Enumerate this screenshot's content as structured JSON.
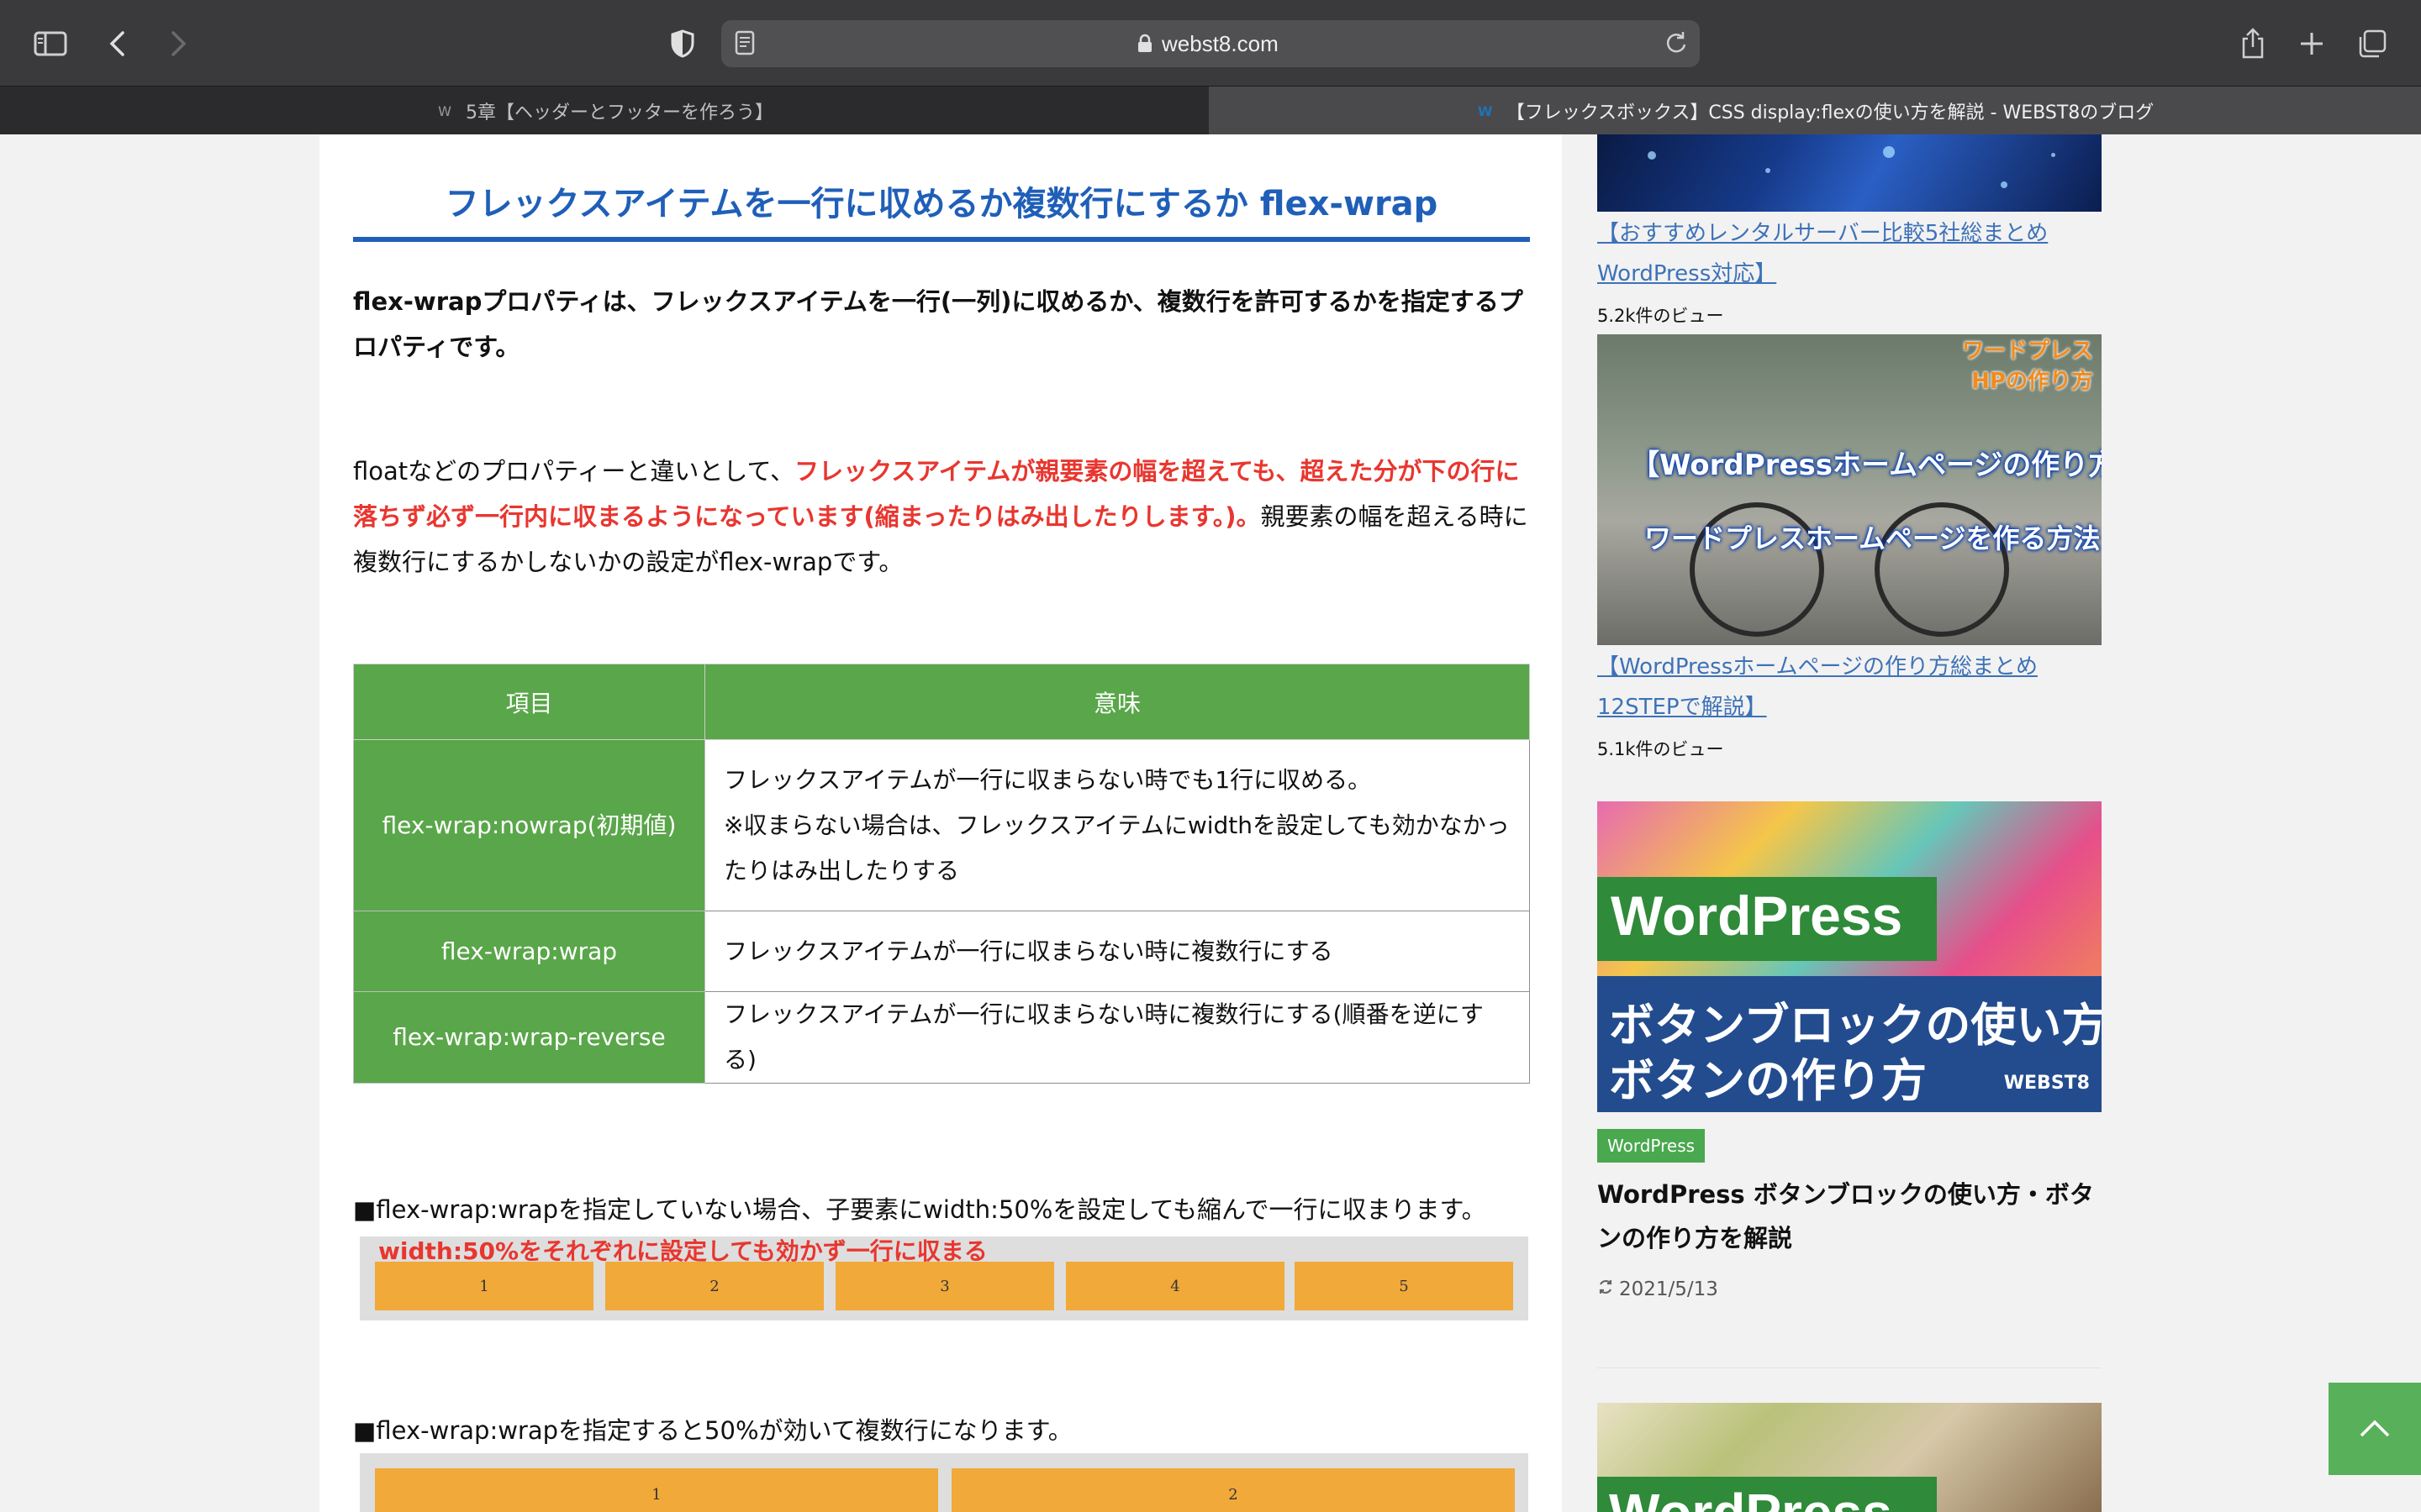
{
  "browser": {
    "url": "webst8.com",
    "tabs": [
      {
        "title": "5章【ヘッダーとフッターを作ろう】",
        "favicon": "W"
      },
      {
        "title": "【フレックスボックス】CSS display:flexの使い方を解説 - WEBST8のブログ",
        "favicon": "W"
      }
    ]
  },
  "article": {
    "heading": "フレックスアイテムを一行に収めるか複数行にするか flex-wrap",
    "intro": "flex-wrapプロパティは、フレックスアイテムを一行(一列)に収めるか、複数行を許可するかを指定するプロパティです。",
    "para2_a": "floatなどのプロパティーと違いとして、",
    "para2_red": "フレックスアイテムが親要素の幅を超えても、超えた分が下の行に落ちず必ず一行内に収まるようになっています(縮まったりはみ出したりします。)。",
    "para2_b": "親要素の幅を超える時に複数行にするかしないかの設定がflex-wrapです。",
    "table": {
      "headers": [
        "項目",
        "意味"
      ],
      "rows": [
        {
          "key": "flex-wrap:nowrap(初期値)",
          "value": "フレックスアイテムが一行に収まらない時でも1行に収める。\n※収まらない場合は、フレックスアイテムにwidthを設定しても効かなかったりはみ出したりする"
        },
        {
          "key": "flex-wrap:wrap",
          "value": "フレックスアイテムが一行に収まらない時に複数行にする"
        },
        {
          "key": "flex-wrap:wrap-reverse",
          "value": "フレックスアイテムが一行に収まらない時に複数行にする(順番を逆にする)"
        }
      ]
    },
    "note1": "■flex-wrap:wrapを指定していない場合、子要素にwidth:50%を設定しても縮んで一行に収まります。",
    "demo1": {
      "caption": "width:50%をそれぞれに設定しても効かず一行に収まる",
      "boxes": [
        "1",
        "2",
        "3",
        "4",
        "5"
      ]
    },
    "note2": "■flex-wrap:wrapを指定すると50%が効いて複数行になります。",
    "demo2": {
      "boxes": [
        "1",
        "2"
      ]
    }
  },
  "sidebar": {
    "items": [
      {
        "link": "【おすすめレンタルサーバー比較5社総まとめWordPress対応】",
        "views": "5.2k件のビュー"
      },
      {
        "link": "【WordPressホームページの作り方総まとめ12STEPで解説】",
        "views": "5.1k件のビュー",
        "image_text": {
          "corner": "ワードプレス\nHPの作り方",
          "title1": "【WordPressホームページの作り方】",
          "title2": "ワードプレスホームページを作る方法"
        }
      }
    ],
    "card": {
      "image_text": {
        "band1": "WordPress",
        "line1": "ボタンブロックの使い方",
        "line2": "ボタンの作り方",
        "logo": "WEBST8"
      },
      "tag": "WordPress",
      "title": "WordPress ボタンブロックの使い方・ボタンの作り方を解説",
      "date": "2021/5/13"
    },
    "next_card": {
      "image_text": "WordPress"
    }
  },
  "colors": {
    "heading_blue": "#1f5fb8",
    "table_green": "#5aa64a",
    "emphasis_red": "#e8362f",
    "link_blue": "#3d72b8",
    "demo_orange": "#f1a93a"
  }
}
